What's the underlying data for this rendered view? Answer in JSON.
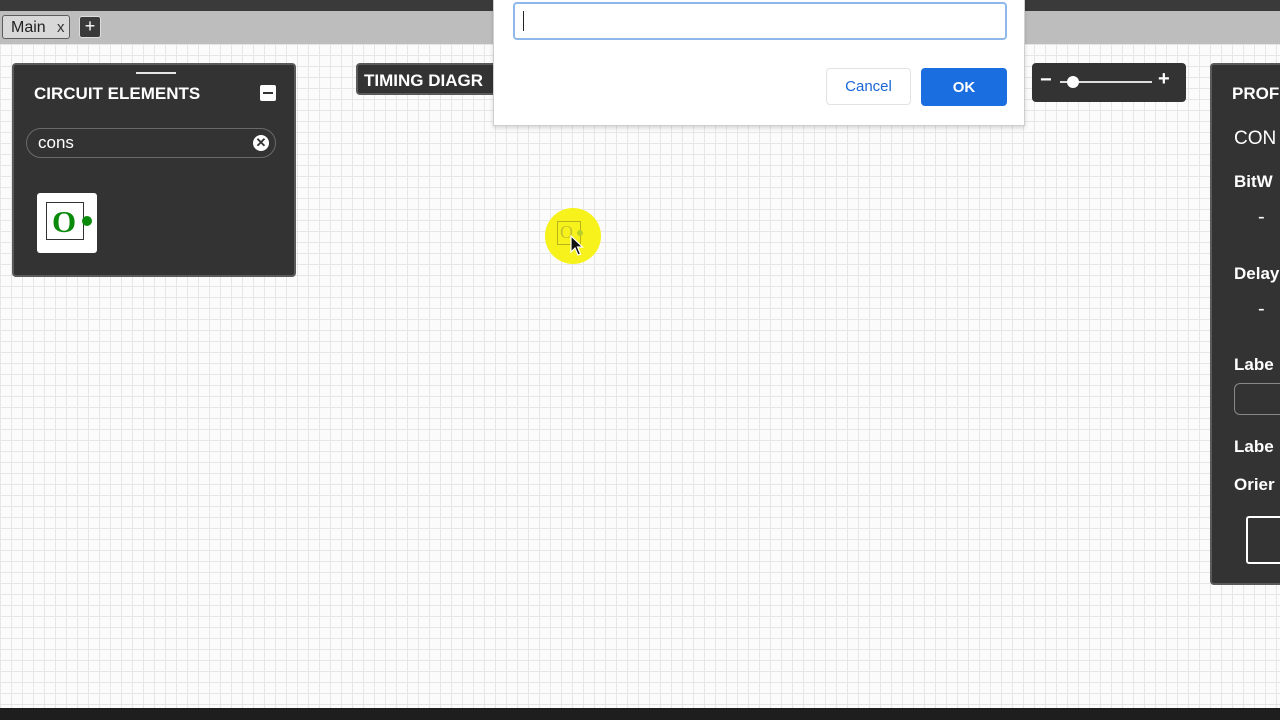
{
  "tabs": {
    "items": [
      {
        "label": "Main",
        "close": "x"
      }
    ],
    "add_label": "+"
  },
  "circuit_elements": {
    "title": "CIRCUIT ELEMENTS",
    "search_value": "cons",
    "results": [
      {
        "icon": "constant-value-icon",
        "symbol": "O"
      }
    ]
  },
  "timing_diagram": {
    "title": "TIMING DIAGR"
  },
  "zoom": {
    "minus": "−",
    "plus": "+",
    "level": 0.2
  },
  "properties": {
    "title": "PROF",
    "element_name": "CON",
    "bitwidth_label": "BitW",
    "bitwidth_dash": "-",
    "delay_label": "Delay",
    "delay_dash": "-",
    "label_label": "Labe",
    "label_direction_label": "Labe",
    "orientation_label": "Orier"
  },
  "canvas": {
    "element_symbol": "O"
  },
  "dialog": {
    "input_value": "",
    "cancel_label": "Cancel",
    "ok_label": "OK"
  },
  "colors": {
    "panel_bg": "#333333",
    "accent_green": "#0a8a0a",
    "highlight_yellow": "#f7f21c",
    "primary_blue": "#1a6ee0"
  }
}
